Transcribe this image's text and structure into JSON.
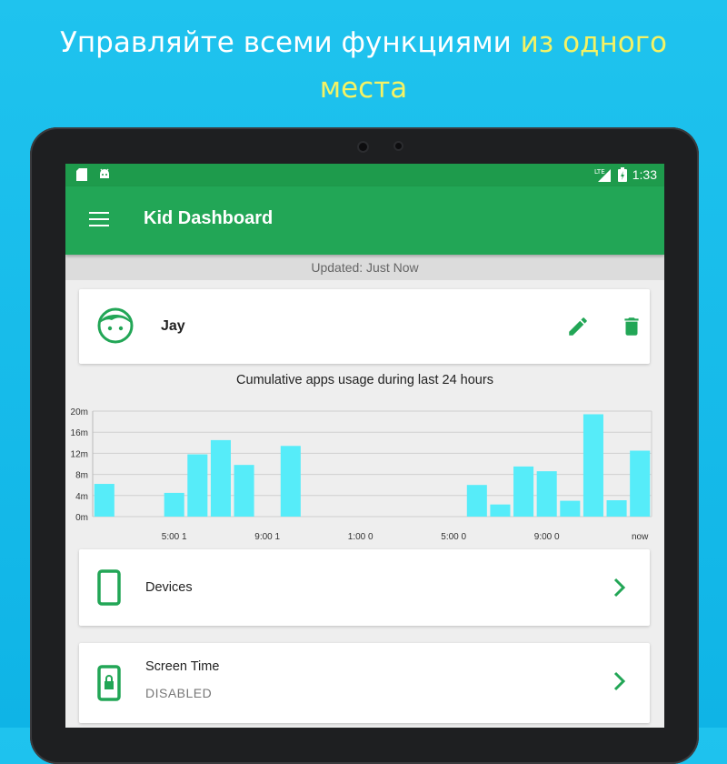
{
  "promo": {
    "line1": "Управляйте всеми функциями",
    "highlight1": "из одного",
    "highlight2": "места"
  },
  "status_bar": {
    "time": "1:33",
    "network": "LTE"
  },
  "app_bar": {
    "title": "Kid Dashboard"
  },
  "updated_text": "Updated: Just Now",
  "kid": {
    "name": "Jay"
  },
  "chart_data": {
    "type": "bar",
    "title": "Cumulative apps usage during last 24 hours",
    "xlabel": "",
    "ylabel": "",
    "y_ticks": [
      "20m",
      "16m",
      "12m",
      "8m",
      "4m",
      "0m"
    ],
    "ylim": [
      0,
      20
    ],
    "x_ticks": [
      "5:00 1",
      "9:00 1",
      "1:00 0",
      "5:00 0",
      "9:00 0",
      "now"
    ],
    "slots": 24,
    "values": [
      6.2,
      0,
      0,
      4.5,
      11.8,
      14.5,
      9.8,
      0,
      13.4,
      0,
      0,
      0,
      0,
      0,
      0,
      0,
      6.0,
      2.3,
      9.5,
      8.6,
      3.0,
      19.4,
      3.1,
      12.5
    ],
    "grid": true,
    "bar_color": "#56ecf9"
  },
  "menu": {
    "devices_label": "Devices",
    "screen_time_label": "Screen Time",
    "screen_time_status": "DISABLED"
  },
  "colors": {
    "accent": "#22a656",
    "status_bar": "#1e9b4c",
    "bars": "#56ecf9",
    "promo_highlight": "#f4f264"
  }
}
